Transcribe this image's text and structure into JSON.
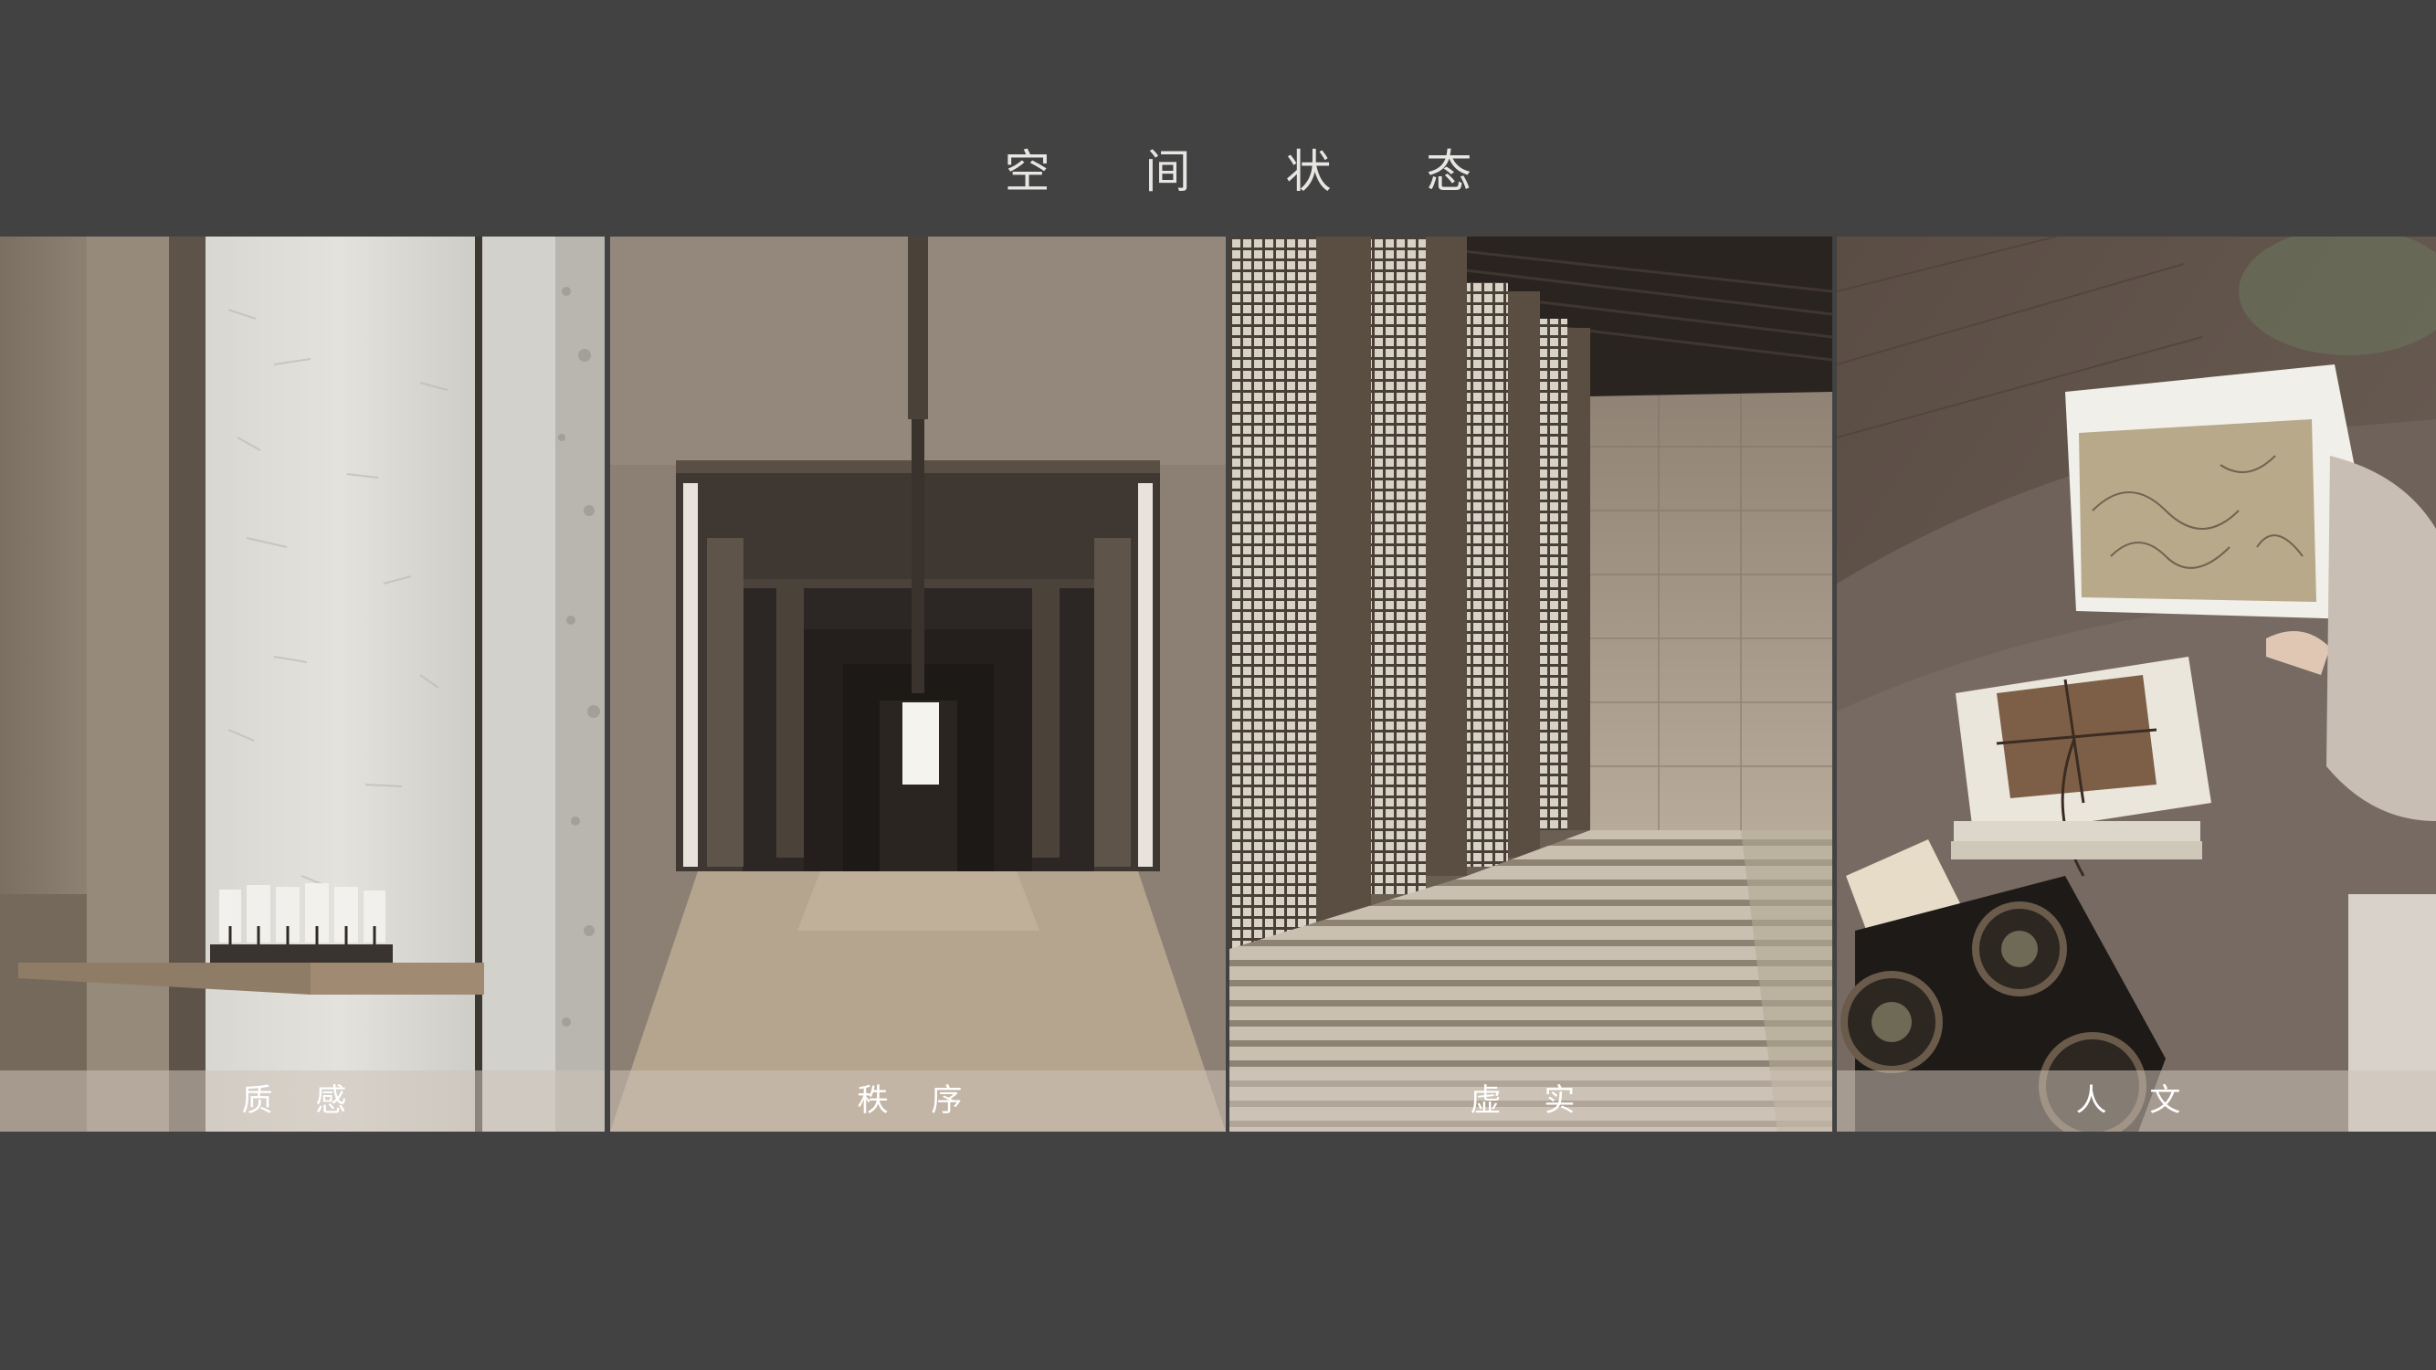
{
  "title": "空 间 状 态",
  "panels": [
    {
      "id": "texture",
      "caption": "质 感"
    },
    {
      "id": "order",
      "caption": "秩 序"
    },
    {
      "id": "void-solid",
      "caption": "虚 实"
    },
    {
      "id": "humanity",
      "caption": "人 文"
    }
  ]
}
